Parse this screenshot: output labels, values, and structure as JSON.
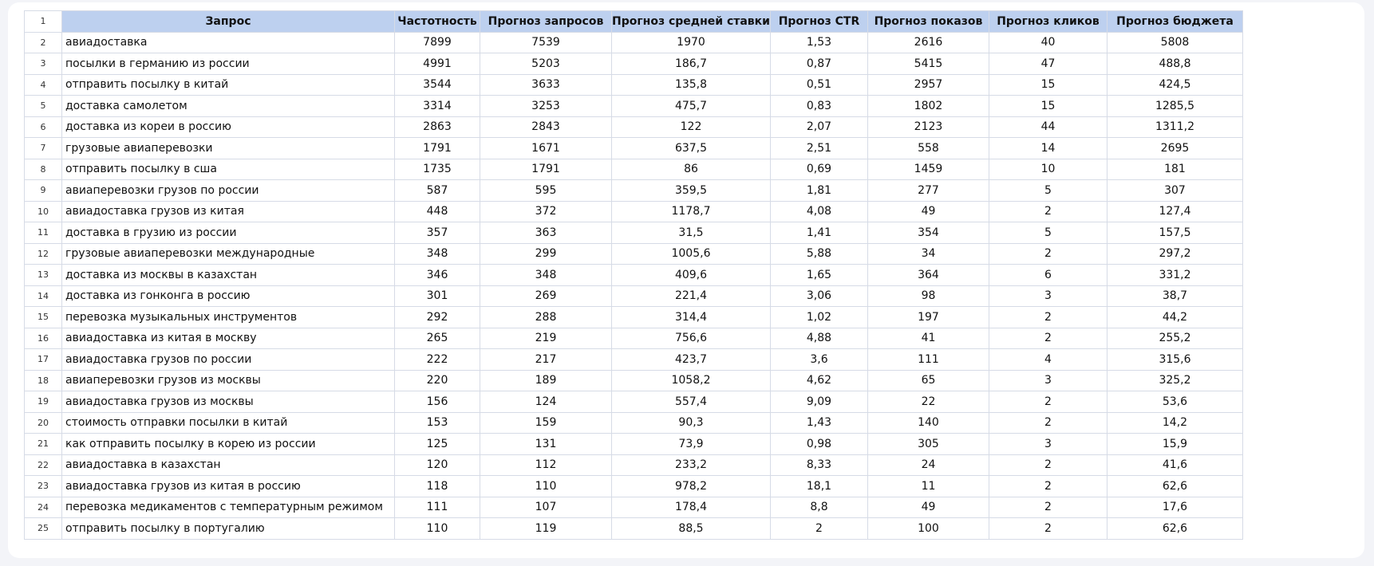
{
  "table": {
    "header_row_number": "1",
    "columns": [
      "Запрос",
      "Частотность",
      "Прогноз запросов",
      "Прогноз средней ставки",
      "Прогноз CTR",
      "Прогноз показов",
      "Прогноз кликов",
      "Прогноз бюджета"
    ],
    "rows": [
      [
        "2",
        "авиадоставка",
        "7899",
        "7539",
        "1970",
        "1,53",
        "2616",
        "40",
        "5808"
      ],
      [
        "3",
        "посылки в германию из россии",
        "4991",
        "5203",
        "186,7",
        "0,87",
        "5415",
        "47",
        "488,8"
      ],
      [
        "4",
        "отправить посылку в китай",
        "3544",
        "3633",
        "135,8",
        "0,51",
        "2957",
        "15",
        "424,5"
      ],
      [
        "5",
        "доставка самолетом",
        "3314",
        "3253",
        "475,7",
        "0,83",
        "1802",
        "15",
        "1285,5"
      ],
      [
        "6",
        "доставка из кореи в россию",
        "2863",
        "2843",
        "122",
        "2,07",
        "2123",
        "44",
        "1311,2"
      ],
      [
        "7",
        "грузовые авиаперевозки",
        "1791",
        "1671",
        "637,5",
        "2,51",
        "558",
        "14",
        "2695"
      ],
      [
        "8",
        "отправить посылку в сша",
        "1735",
        "1791",
        "86",
        "0,69",
        "1459",
        "10",
        "181"
      ],
      [
        "9",
        "авиаперевозки грузов по россии",
        "587",
        "595",
        "359,5",
        "1,81",
        "277",
        "5",
        "307"
      ],
      [
        "10",
        "авиадоставка грузов из китая",
        "448",
        "372",
        "1178,7",
        "4,08",
        "49",
        "2",
        "127,4"
      ],
      [
        "11",
        "доставка в грузию из россии",
        "357",
        "363",
        "31,5",
        "1,41",
        "354",
        "5",
        "157,5"
      ],
      [
        "12",
        "грузовые авиаперевозки международные",
        "348",
        "299",
        "1005,6",
        "5,88",
        "34",
        "2",
        "297,2"
      ],
      [
        "13",
        "доставка из москвы в казахстан",
        "346",
        "348",
        "409,6",
        "1,65",
        "364",
        "6",
        "331,2"
      ],
      [
        "14",
        "доставка из гонконга в россию",
        "301",
        "269",
        "221,4",
        "3,06",
        "98",
        "3",
        "38,7"
      ],
      [
        "15",
        "перевозка музыкальных инструментов",
        "292",
        "288",
        "314,4",
        "1,02",
        "197",
        "2",
        "44,2"
      ],
      [
        "16",
        "авиадоставка из китая в москву",
        "265",
        "219",
        "756,6",
        "4,88",
        "41",
        "2",
        "255,2"
      ],
      [
        "17",
        "авиадоставка грузов по россии",
        "222",
        "217",
        "423,7",
        "3,6",
        "111",
        "4",
        "315,6"
      ],
      [
        "18",
        "авиаперевозки грузов из москвы",
        "220",
        "189",
        "1058,2",
        "4,62",
        "65",
        "3",
        "325,2"
      ],
      [
        "19",
        "авиадоставка грузов из москвы",
        "156",
        "124",
        "557,4",
        "9,09",
        "22",
        "2",
        "53,6"
      ],
      [
        "20",
        "стоимость отправки посылки в китай",
        "153",
        "159",
        "90,3",
        "1,43",
        "140",
        "2",
        "14,2"
      ],
      [
        "21",
        "как отправить посылку в корею из россии",
        "125",
        "131",
        "73,9",
        "0,98",
        "305",
        "3",
        "15,9"
      ],
      [
        "22",
        "авиадоставка в казахстан",
        "120",
        "112",
        "233,2",
        "8,33",
        "24",
        "2",
        "41,6"
      ],
      [
        "23",
        "авиадоставка грузов из китая в россию",
        "118",
        "110",
        "978,2",
        "18,1",
        "11",
        "2",
        "62,6"
      ],
      [
        "24",
        "перевозка медикаментов с температурным режимом",
        "111",
        "107",
        "178,4",
        "8,8",
        "49",
        "2",
        "17,6"
      ],
      [
        "25",
        "отправить посылку в португалию",
        "110",
        "119",
        "88,5",
        "2",
        "100",
        "2",
        "62,6"
      ]
    ]
  },
  "colors": {
    "header_background": "#bdd0ef",
    "grid_line": "#d6dbe6",
    "page_background": "#f3f4f8"
  }
}
